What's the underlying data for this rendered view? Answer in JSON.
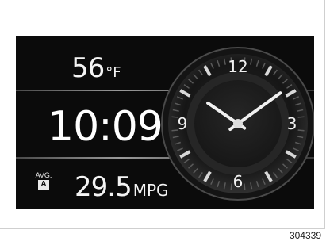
{
  "display": {
    "temperature": {
      "value": "56",
      "unit": "°F"
    },
    "time": "10:09",
    "fuel_economy": {
      "avg_label": "AVG.",
      "mode_badge": "A",
      "value": "29.5",
      "unit": "MPG"
    }
  },
  "clock": {
    "numerals": {
      "twelve": "12",
      "three": "3",
      "six": "6",
      "nine": "9"
    },
    "hour": 10,
    "minute": 9
  },
  "caption": "304339",
  "colors": {
    "background": "#0b0b0b",
    "text": "#f4f4f4"
  }
}
